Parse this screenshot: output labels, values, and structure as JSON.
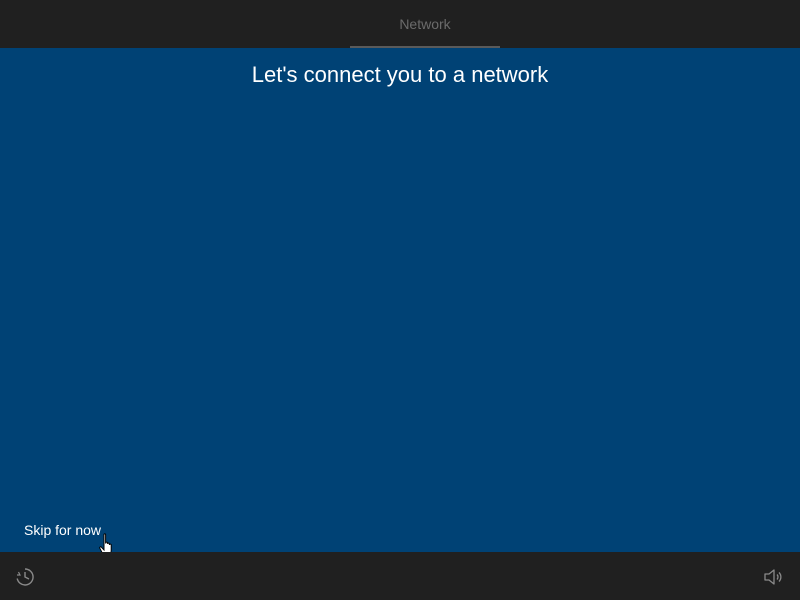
{
  "header": {
    "tabs": [
      {
        "label": "Network",
        "active": true
      }
    ]
  },
  "main": {
    "title": "Let's connect you to a network",
    "skip_label": "Skip for now"
  },
  "footer": {
    "left_icon": "ease-of-access-icon",
    "right_icon": "volume-icon"
  },
  "colors": {
    "background_blue": "#004275",
    "bar_dark": "#202020",
    "tab_text": "#6b6b6b",
    "tab_underline": "#5a5a5a"
  }
}
